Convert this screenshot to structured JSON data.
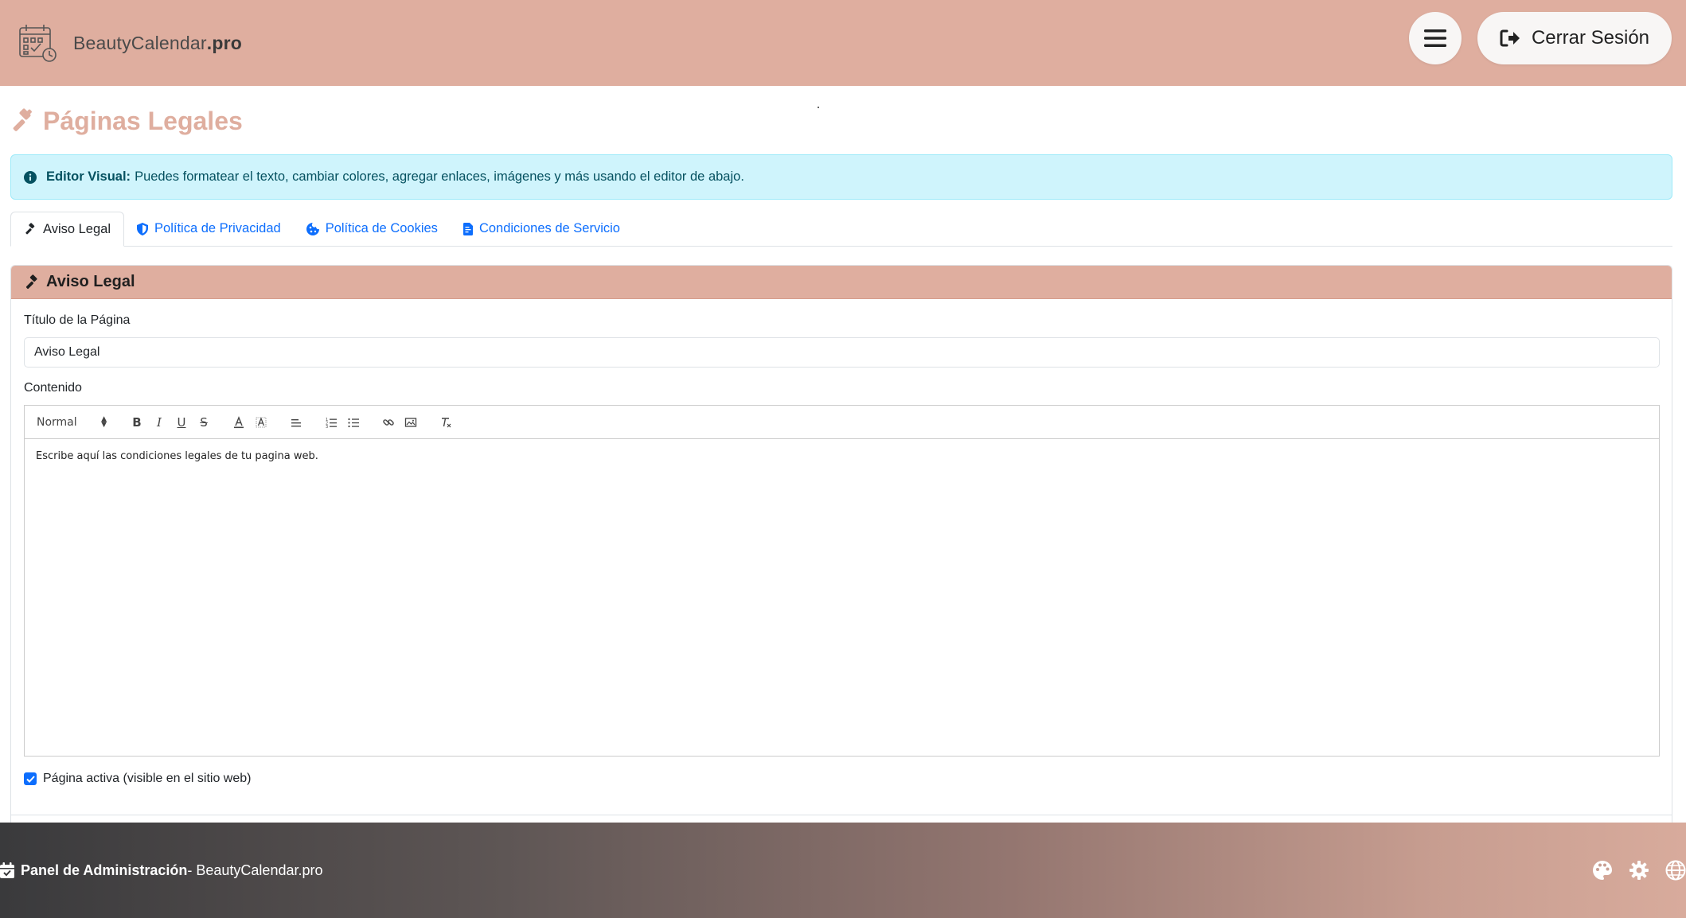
{
  "header": {
    "brand_prefix": "BeautyCalendar",
    "brand_suffix": ".pro",
    "logout_label": "Cerrar Sesión",
    "background_color": "#dfae9f"
  },
  "page": {
    "title": "Páginas Legales"
  },
  "alert": {
    "strong": "Editor Visual:",
    "text": "Puedes formatear el texto, cambiar colores, agregar enlaces, imágenes y más usando el editor de abajo."
  },
  "tabs": [
    {
      "label": "Aviso Legal",
      "icon": "gavel-icon",
      "active": true
    },
    {
      "label": "Política de Privacidad",
      "icon": "shield-icon",
      "active": false
    },
    {
      "label": "Política de Cookies",
      "icon": "cookie-icon",
      "active": false
    },
    {
      "label": "Condiciones de Servicio",
      "icon": "file-contract-icon",
      "active": false
    }
  ],
  "card": {
    "header": "Aviso Legal",
    "title_label": "Título de la Página",
    "title_value": "Aviso Legal",
    "content_label": "Contenido",
    "editor": {
      "format_select": "Normal",
      "body_text": "Escribe aquí las condiciones legales de tu pagina web."
    },
    "active_label": "Página activa (visible en el sitio web)",
    "active_checked": true
  },
  "footer": {
    "title": "Panel de Administración",
    "subtitle": " - BeautyCalendar.pro",
    "icons": [
      "palette-icon",
      "gear-icon",
      "globe-icon"
    ]
  },
  "colors": {
    "accent": "#dfae9f",
    "link": "#0d6efd",
    "alert_bg": "#cff4fc",
    "alert_text": "#055160"
  }
}
